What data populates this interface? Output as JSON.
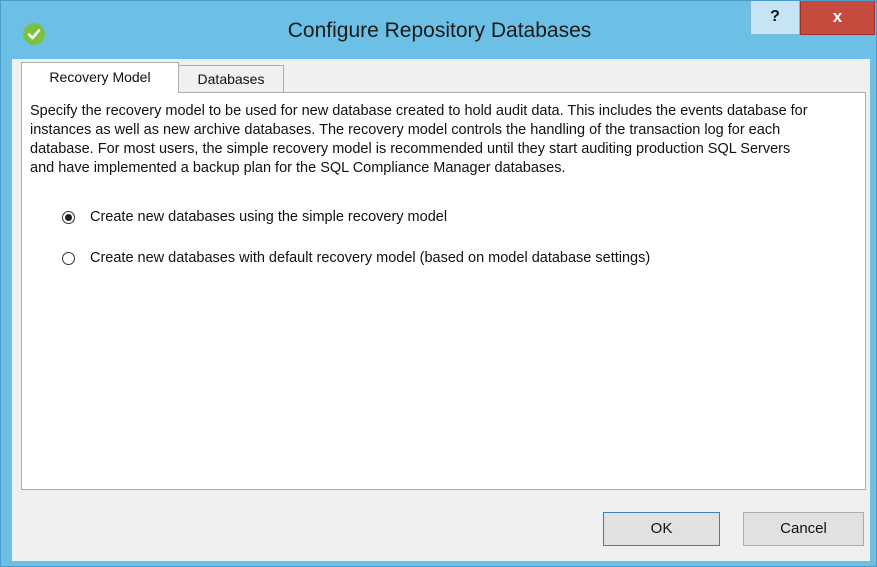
{
  "window": {
    "title": "Configure Repository Databases",
    "help_label": "?",
    "close_label": "x"
  },
  "tabs": [
    {
      "label": "Recovery Model",
      "selected": true
    },
    {
      "label": "Databases",
      "selected": false
    }
  ],
  "recovery_model": {
    "description": "Specify the recovery model to be used for new database created to hold audit data. This includes the events database for instances as well as new archive databases. The recovery model controls the handling of the transaction log for each database. For most users, the simple recovery model is recommended until they start auditing production SQL Servers and have implemented a backup plan for the SQL Compliance Manager databases.",
    "options": [
      {
        "label": "Create new databases using the simple recovery model",
        "checked": true
      },
      {
        "label": "Create new databases with default recovery model (based on model database settings)",
        "checked": false
      }
    ]
  },
  "buttons": {
    "ok": "OK",
    "cancel": "Cancel"
  },
  "colors": {
    "titlebar": "#6cc0e6",
    "close": "#c44b3d",
    "app_icon": "#7ac142"
  }
}
